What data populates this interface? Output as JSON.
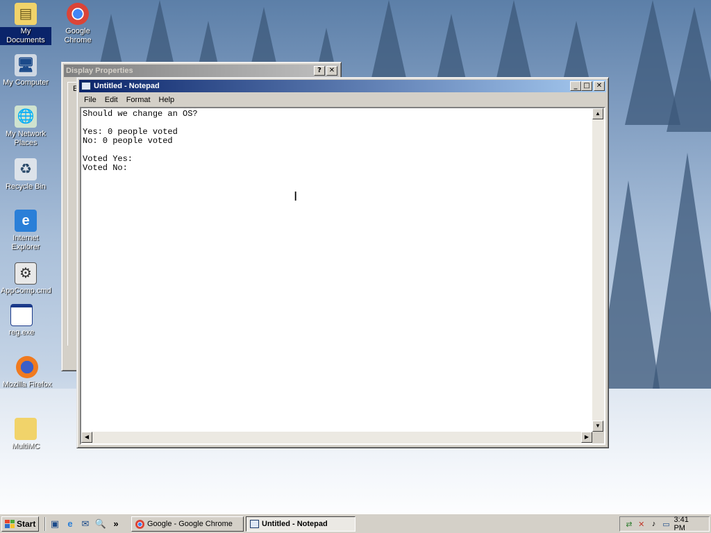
{
  "desktop": {
    "icons": [
      {
        "label": "My Documents",
        "icon": "folder-documents-icon"
      },
      {
        "label": "Google Chrome",
        "icon": "chrome-icon"
      },
      {
        "label": "My Computer",
        "icon": "computer-icon"
      },
      {
        "label": "My Network Places",
        "icon": "network-icon"
      },
      {
        "label": "Recycle Bin",
        "icon": "recycle-bin-icon"
      },
      {
        "label": "Internet Explorer",
        "icon": "ie-icon"
      },
      {
        "label": "AppComp.cmd",
        "icon": "cmd-icon"
      },
      {
        "label": "reg.exe",
        "icon": "exe-icon"
      },
      {
        "label": "Mozilla Firefox",
        "icon": "firefox-icon"
      },
      {
        "label": "MultiMC",
        "icon": "folder-icon"
      }
    ]
  },
  "display_properties": {
    "title": "Display Properties",
    "help_btn": "?",
    "close_btn": "✕",
    "partial_text": "E"
  },
  "notepad": {
    "title": "Untitled - Notepad",
    "controls": {
      "minimize": "_",
      "maximize": "□",
      "close": "✕"
    },
    "menu": [
      "File",
      "Edit",
      "Format",
      "Help"
    ],
    "lines": [
      "Should we change an OS?",
      "",
      "Yes: 0 people voted",
      "No: 0 people voted",
      "",
      "Voted Yes:",
      "Voted No:"
    ]
  },
  "taskbar": {
    "start_label": "Start",
    "tasks": [
      {
        "label": "Google - Google Chrome",
        "icon": "chrome-icon"
      },
      {
        "label": "Untitled - Notepad",
        "icon": "notepad-icon"
      }
    ],
    "quick_launch_more": "»",
    "clock": "3:41 PM"
  },
  "colors": {
    "titlebar_active": "#0a246a",
    "window_face": "#d4d0c8"
  }
}
